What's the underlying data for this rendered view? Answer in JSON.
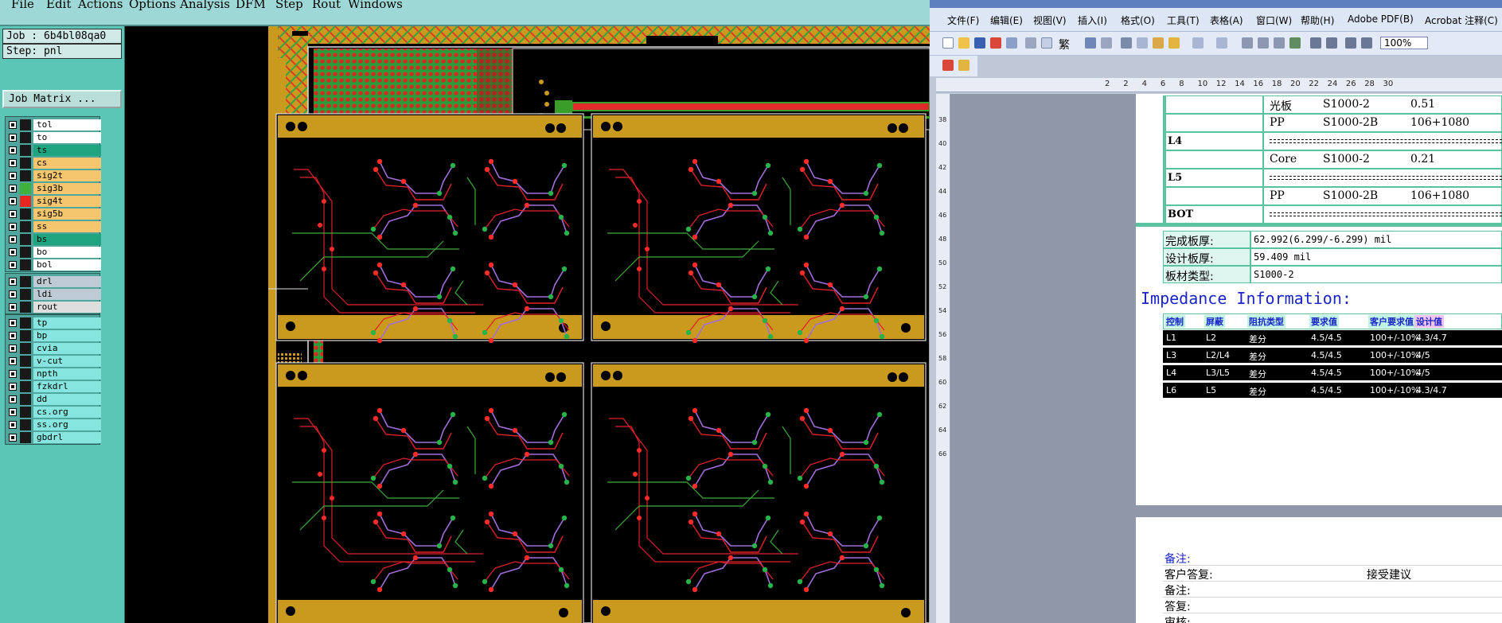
{
  "cam": {
    "menu": [
      "File",
      "Edit",
      "Actions",
      "Options",
      "Analysis",
      "DFM",
      "Step",
      "Rout",
      "Windows"
    ],
    "job_label": "Job : 6b4bl08qa0",
    "step_label": "Step: pnl",
    "job_matrix_button": "Job Matrix ...",
    "layer_groups": [
      {
        "layers": [
          {
            "name": "tol",
            "color": "#ffffff"
          },
          {
            "name": "to",
            "color": "#ffffff"
          },
          {
            "name": "ts",
            "color": "#1ea47e"
          },
          {
            "name": "cs",
            "color": "#f6c66e"
          },
          {
            "name": "sig2t",
            "color": "#f6c66e"
          },
          {
            "name": "sig3b",
            "color": "#f6c66e"
          },
          {
            "name": "sig4t",
            "color": "#f6c66e"
          },
          {
            "name": "sig5b",
            "color": "#f6c66e"
          },
          {
            "name": "ss",
            "color": "#f6c66e"
          },
          {
            "name": "bs",
            "color": "#1ea47e"
          },
          {
            "name": "bo",
            "color": "#ffffff"
          },
          {
            "name": "bol",
            "color": "#ffffff"
          }
        ]
      },
      {
        "layers": [
          {
            "name": "drl",
            "color": "#bfcbd4"
          },
          {
            "name": "ldi",
            "color": "#bfcbd4"
          },
          {
            "name": "rout",
            "color": "#dedede"
          }
        ]
      },
      {
        "layers": [
          {
            "name": "tp",
            "color": "#86e5de"
          },
          {
            "name": "bp",
            "color": "#86e5de"
          },
          {
            "name": "cvia",
            "color": "#86e5de"
          },
          {
            "name": "v-cut",
            "color": "#86e5de"
          },
          {
            "name": "npth",
            "color": "#86e5de"
          },
          {
            "name": "fzkdrl",
            "color": "#86e5de"
          },
          {
            "name": "dd",
            "color": "#86e5de"
          },
          {
            "name": "cs.org",
            "color": "#86e5de"
          },
          {
            "name": "ss.org",
            "color": "#86e5de"
          },
          {
            "name": "gbdrl",
            "color": "#86e5de"
          }
        ]
      }
    ],
    "board_colors": {
      "frame": "#c99a1d",
      "trace_red": "#e0202a",
      "trace_green": "#40a93c",
      "trace_purple": "#a26ddb",
      "pad_red": "#ff2a2a",
      "pad_green": "#26b34a"
    }
  },
  "word": {
    "menu": [
      "文件(F)",
      "编辑(E)",
      "视图(V)",
      "插入(I)",
      "格式(O)",
      "工具(T)",
      "表格(A)",
      "窗口(W)",
      "帮助(H)",
      "Adobe PDF(B)",
      "Acrobat 注释(C)"
    ],
    "zoom": "100%",
    "ruler_numbers": [
      "2",
      "2",
      "4",
      "6",
      "8",
      "10",
      "12",
      "14",
      "16",
      "18",
      "20",
      "22",
      "24",
      "26",
      "28",
      "30"
    ],
    "vruler_numbers": [
      "38",
      "40",
      "42",
      "44",
      "46",
      "48",
      "50",
      "52",
      "54",
      "56",
      "58",
      "60",
      "62",
      "64",
      "66"
    ],
    "stackup": [
      {
        "layer": "",
        "material": "光板",
        "spec": "S1000-2",
        "value": "0.51"
      },
      {
        "layer": "",
        "material": "PP",
        "spec": "S1000-2B",
        "value": "106+1080"
      },
      {
        "layer": "L4",
        "material": "",
        "spec": "",
        "value": ""
      },
      {
        "layer": "",
        "material": "Core",
        "spec": "S1000-2",
        "value": "0.21"
      },
      {
        "layer": "L5",
        "material": "",
        "spec": "",
        "value": ""
      },
      {
        "layer": "",
        "material": "PP",
        "spec": "S1000-2B",
        "value": "106+1080"
      },
      {
        "layer": "BOT",
        "material": "",
        "spec": "",
        "value": ""
      }
    ],
    "props": [
      {
        "label": "完成板厚:",
        "value": "62.992(6.299/-6.299) mil"
      },
      {
        "label": "设计板厚:",
        "value": "59.409 mil"
      },
      {
        "label": "板材类型:",
        "value": "S1000-2"
      }
    ],
    "impedance_title": "Impedance Information:",
    "impedance_headers": [
      "控制",
      "屏蔽",
      "阻抗类型",
      "要求值",
      "客户要求值",
      "设计值"
    ],
    "impedance_rows": [
      [
        "L1",
        "L2",
        "差分",
        "4.5/4.5",
        "100+/-10%",
        "4.3/4.7"
      ],
      [
        "L3",
        "L2/L4",
        "差分",
        "4.5/4.5",
        "100+/-10%",
        "4/5"
      ],
      [
        "L4",
        "L3/L5",
        "差分",
        "4.5/4.5",
        "100+/-10%",
        "4/5"
      ],
      [
        "L6",
        "L5",
        "差分",
        "4.5/4.5",
        "100+/-10%",
        "4.3/4.7"
      ]
    ],
    "notes": [
      {
        "label": "备注:",
        "value": ""
      },
      {
        "label": "客户答复:",
        "value": "接受建议"
      },
      {
        "label": "备注:",
        "value": ""
      },
      {
        "label": "答复:",
        "value": ""
      },
      {
        "label": "审核:",
        "value": ""
      }
    ]
  }
}
